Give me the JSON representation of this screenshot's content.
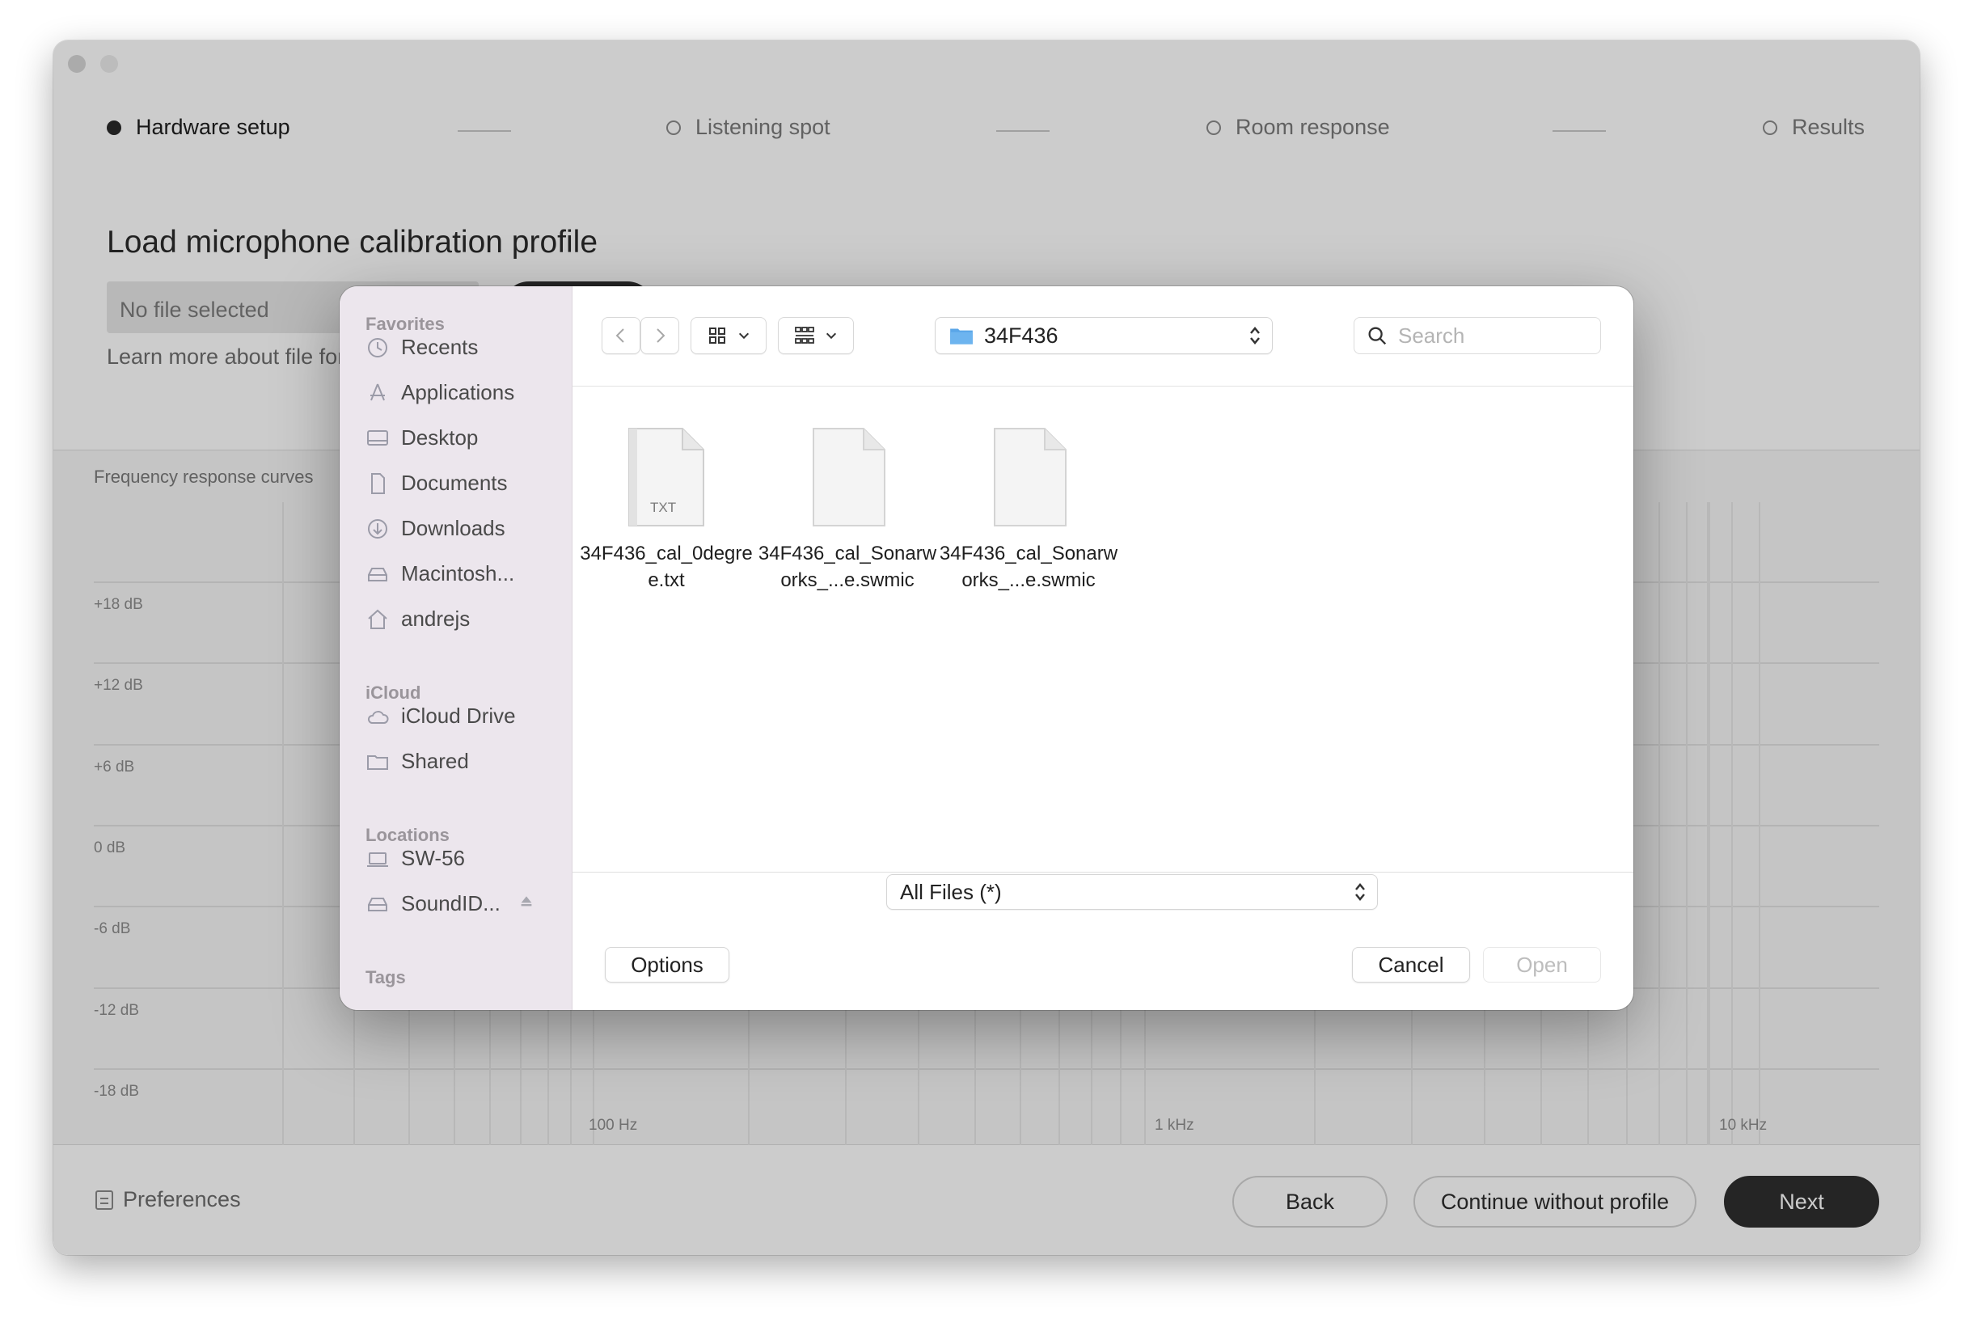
{
  "app": {
    "steps": [
      {
        "label": "Hardware setup",
        "active": true
      },
      {
        "label": "Listening spot",
        "active": false
      },
      {
        "label": "Room response",
        "active": false
      },
      {
        "label": "Results",
        "active": false
      }
    ],
    "title": "Load microphone calibration profile",
    "file_field": "No file selected",
    "learn_link": "Learn more about file formats",
    "chart": {
      "title": "Frequency response curves",
      "db_labels": [
        "+18 dB",
        "+12 dB",
        "+6 dB",
        "0 dB",
        "-6 dB",
        "-12 dB",
        "-18 dB"
      ],
      "freq_labels": [
        "100 Hz",
        "1 kHz",
        "10 kHz"
      ]
    },
    "bottom": {
      "preferences": "Preferences",
      "back": "Back",
      "continue": "Continue without profile",
      "next": "Next"
    }
  },
  "dialog": {
    "sidebar": {
      "favorites_title": "Favorites",
      "favorites": [
        {
          "label": "Recents",
          "icon": "clock-icon"
        },
        {
          "label": "Applications",
          "icon": "applications-icon"
        },
        {
          "label": "Desktop",
          "icon": "desktop-icon"
        },
        {
          "label": "Documents",
          "icon": "document-icon"
        },
        {
          "label": "Downloads",
          "icon": "download-icon"
        },
        {
          "label": "Macintosh...",
          "icon": "disk-icon"
        },
        {
          "label": "andrejs",
          "icon": "home-icon"
        }
      ],
      "icloud_title": "iCloud",
      "icloud": [
        {
          "label": "iCloud Drive",
          "icon": "cloud-icon"
        },
        {
          "label": "Shared",
          "icon": "shared-folder-icon"
        }
      ],
      "locations_title": "Locations",
      "locations": [
        {
          "label": "SW-56",
          "icon": "laptop-icon"
        },
        {
          "label": "SoundID...",
          "icon": "disk-icon"
        }
      ],
      "tags_title": "Tags"
    },
    "toolbar": {
      "folder": "34F436",
      "search_placeholder": "Search"
    },
    "files": [
      {
        "name": "34F436_cal_0degree.txt",
        "badge": "TXT"
      },
      {
        "name": "34F436_cal_Sonarworks_...e.swmic",
        "badge": ""
      },
      {
        "name": "34F436_cal_Sonarworks_...e.swmic",
        "badge": ""
      }
    ],
    "filter": "All Files (*)",
    "buttons": {
      "options": "Options",
      "cancel": "Cancel",
      "open": "Open"
    },
    "colors": {
      "sidebar_bg": "#ece6ed",
      "folder_blue": "#5aa6e8"
    }
  }
}
